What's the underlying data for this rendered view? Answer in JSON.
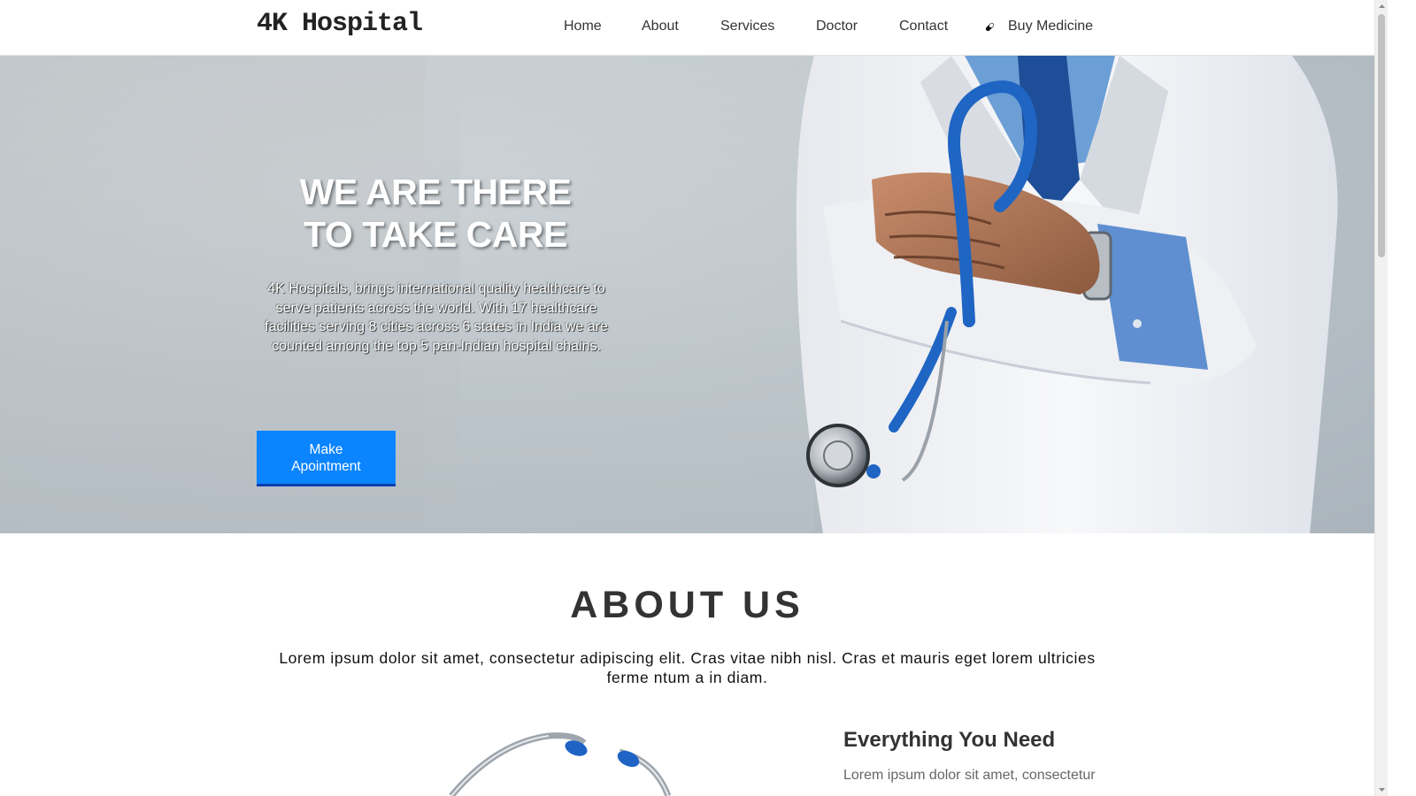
{
  "header": {
    "brand": "4K Hospital",
    "nav": {
      "home": "Home",
      "about": "About",
      "services": "Services",
      "doctor": "Doctor",
      "contact": "Contact",
      "buy_medicine": "Buy Medicine"
    },
    "buy_medicine_icon": "pill-icon"
  },
  "hero": {
    "title_line1": "WE ARE THERE",
    "title_line2_prefix": "TO ",
    "title_line2_bold": "TAKE CARE",
    "text": "4K Hospitals, brings international quality healthcare to serve patients across the world. With 17 healthcare facilities serving 8 cities across 6 states in India we are counted among the top 5 pan-Indian hospital chains.",
    "cta_line1": "Make",
    "cta_line2": "Apointment",
    "cta_color": "#0a84ff"
  },
  "about": {
    "title": "ABOUT US",
    "text": "Lorem ipsum dolor sit amet, consectetur adipiscing elit. Cras vitae nibh nisl. Cras et mauris eget lorem ultricies ferme ntum a in diam.",
    "feature_title": "Everything You Need",
    "feature_text": "Lorem ipsum dolor sit amet, consectetur"
  }
}
